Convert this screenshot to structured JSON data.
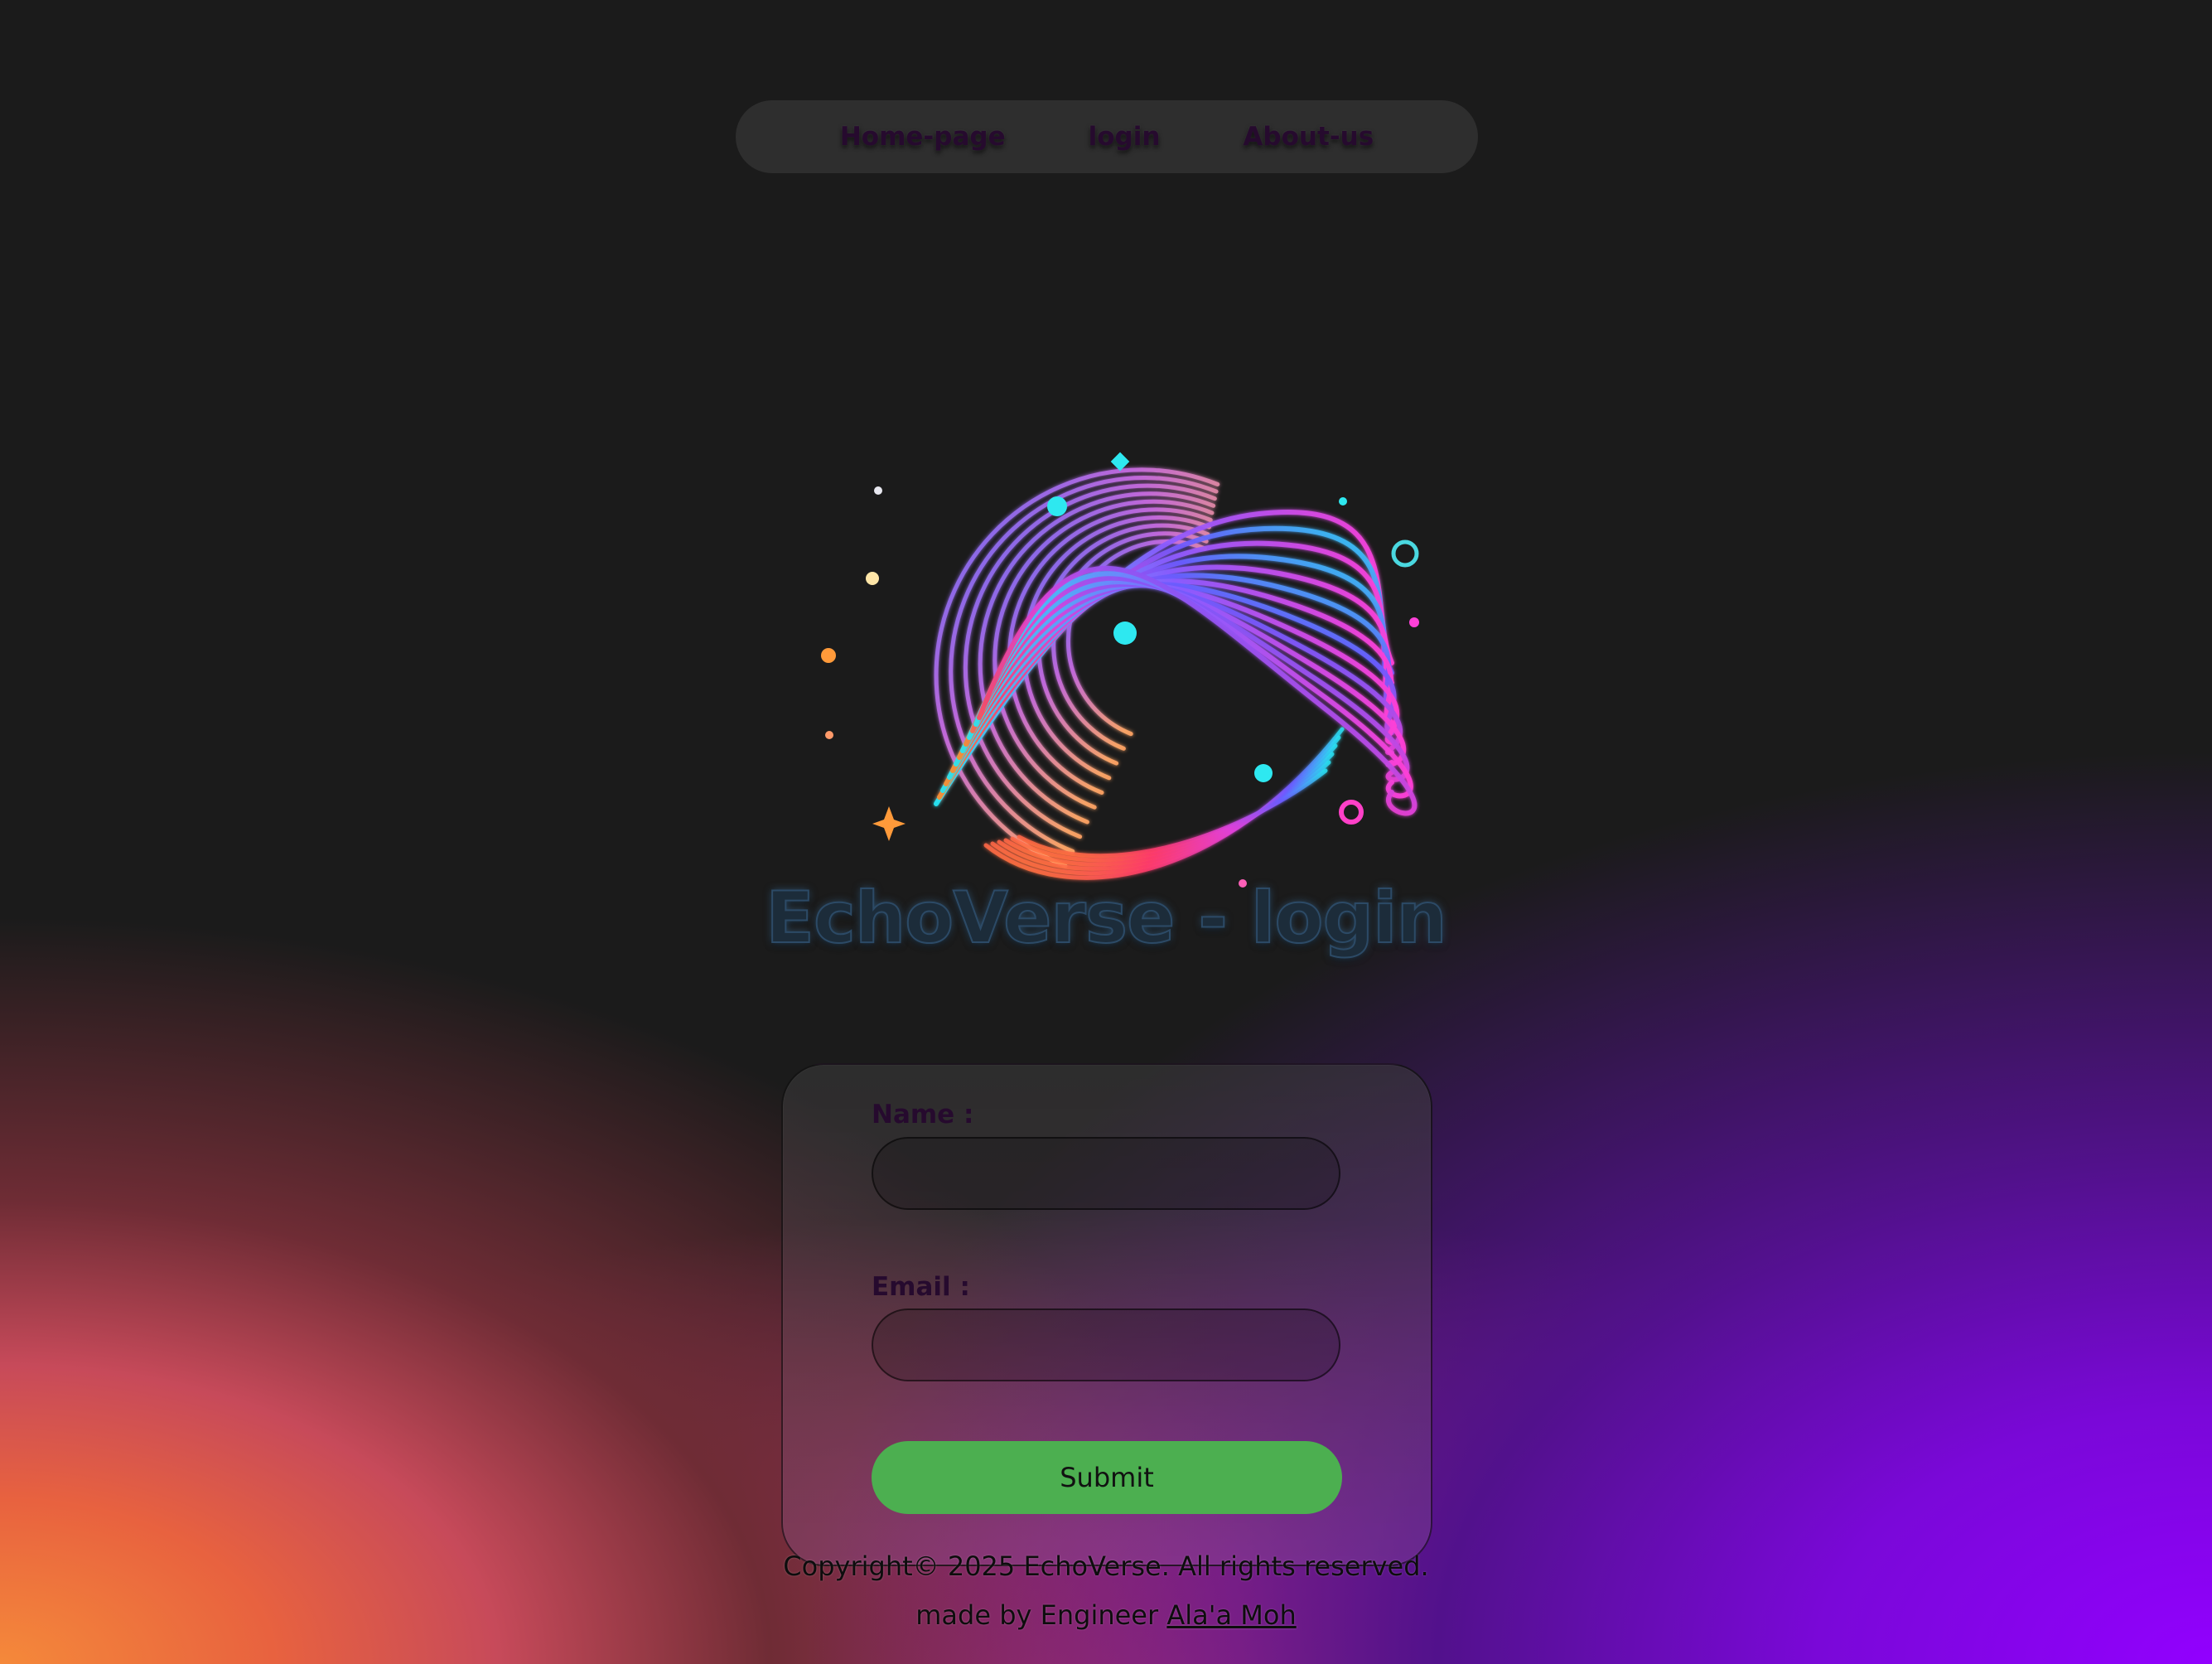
{
  "nav": {
    "items": [
      {
        "label": "Home-page"
      },
      {
        "label": "login"
      },
      {
        "label": "About-us"
      }
    ]
  },
  "header": {
    "title": "EchoVerse - login"
  },
  "form": {
    "name_label": "Name :",
    "name_value": "",
    "email_label": "Email :",
    "email_value": "",
    "submit_label": "Submit"
  },
  "footer": {
    "copyright": "Copyright© 2025 EchoVerse. All rights reserved.",
    "made_by_prefix": "made by Engineer ",
    "author_link": "Ala'a Moh"
  },
  "colors": {
    "page_background": "#1b1b1b",
    "nav_background": "#2e2e2e",
    "nav_text": "#260a2e",
    "submit_button": "#4caf50",
    "gradient_purple": "#9200ff",
    "gradient_orange": "#f5893a"
  },
  "icons": {
    "logo": "swirl-fingerprint-logo"
  }
}
